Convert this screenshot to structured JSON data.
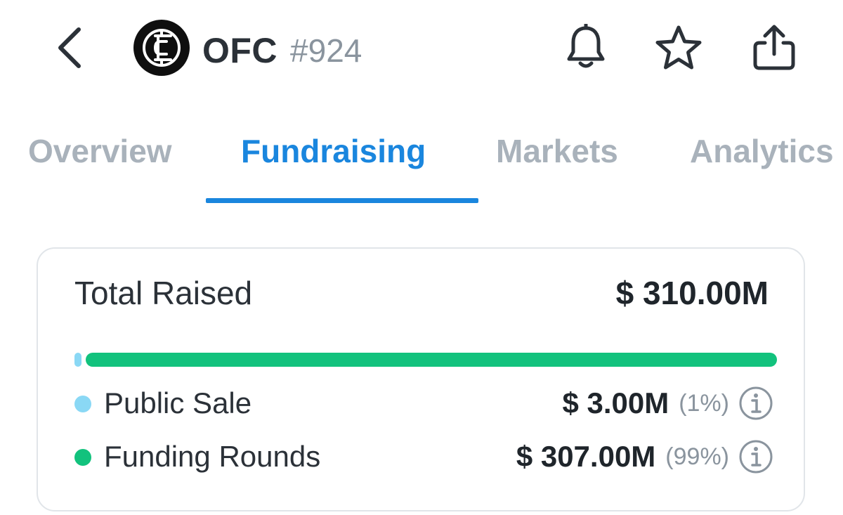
{
  "header": {
    "symbol": "OFC",
    "rank": "#924",
    "icons": {
      "back": "chevron-left-icon",
      "logo": "ofc-monogram-logo",
      "bell": "bell-icon",
      "star": "star-icon",
      "share": "share-icon"
    }
  },
  "tabs": [
    {
      "label": "Overview",
      "active": false
    },
    {
      "label": "Fundraising",
      "active": true
    },
    {
      "label": "Markets",
      "active": false
    },
    {
      "label": "Analytics",
      "active": false
    }
  ],
  "fundraising": {
    "total_label": "Total Raised",
    "total_value": "$ 310.00M",
    "breakdown": [
      {
        "label": "Public Sale",
        "amount": "$ 3.00M",
        "percent": "(1%)",
        "share": 0.01,
        "color": "#8ad8f5"
      },
      {
        "label": "Funding Rounds",
        "amount": "$ 307.00M",
        "percent": "(99%)",
        "share": 0.99,
        "color": "#12c27d"
      }
    ]
  },
  "colors": {
    "accent": "#1a86de",
    "tab_inactive": "#a9b2bb",
    "card_border": "#e1e5e9"
  }
}
